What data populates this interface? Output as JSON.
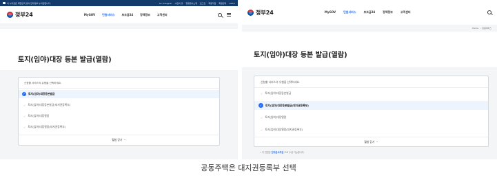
{
  "left": {
    "util_bar": {
      "notice": "이 누리집은 대한민국 공식 전자정부 누리집입니다.",
      "links": [
        "for foreigner",
        "시민의 규",
        "행정청사소개",
        "로그인",
        "회원가입",
        "회원관리",
        "100%"
      ]
    },
    "logo": "정부24",
    "nav": [
      "MyGOV",
      "민원서비스",
      "보조금24",
      "정책정보",
      "고객센터"
    ],
    "page_title": "토지(임야)대장 등본 발급(열람)",
    "prompt": "신청할 서비스의 유형을 선택하세요.",
    "options": [
      "토지(임야)대장등본발급",
      "토지(임야)대장등본발급(대지권등록부)",
      "토지(임야)대장열람",
      "토지(임야)대장열람(대지권등록부)"
    ],
    "fold_label": "펼침 닫기"
  },
  "right": {
    "logo": "정부24",
    "nav": [
      "MyGOV",
      "민원서비스",
      "보조금24",
      "정책정보",
      "고객센터"
    ],
    "breadcrumb": [
      "Home",
      "민원서비스"
    ],
    "page_title": "토지(임야)대장 등본 발급(열람)",
    "prompt": "신청할 서비스의 유형을 선택하세요.",
    "options": [
      "토지(임야)대장등본발급",
      "토지(임야)대장등본발급(대지권등록부)",
      "토지(임야)대장열람",
      "토지(임야)대장열람(대지권등록부)"
    ],
    "fold_label": "펼침 닫기",
    "note_prefix": "이 민원은",
    "note_link": "전자문서지갑",
    "note_suffix": "으로 수령 가능합니다."
  },
  "caption": "공동주택은 대지권등록부 선택",
  "colors": {
    "primary": "#256ef4",
    "header_bar": "#123a6b",
    "selected_bg": "#eef4fd"
  }
}
